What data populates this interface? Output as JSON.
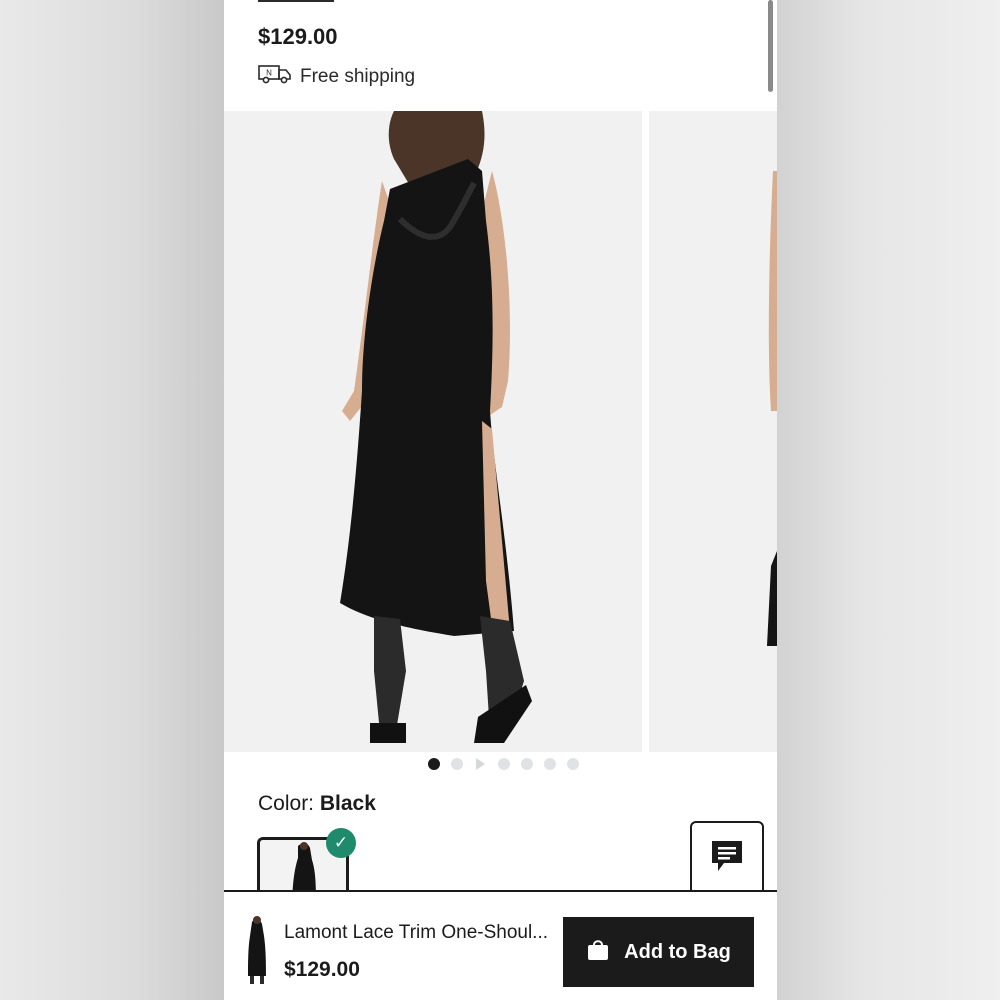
{
  "product": {
    "price": "$129.00",
    "shipping_text": "Free shipping",
    "color_prefix": "Color: ",
    "color_value": "Black"
  },
  "gallery": {
    "image_count": 6,
    "active_index": 0
  },
  "bottom_bar": {
    "title": "Lamont Lace Trim One-Shoul...",
    "price": "$129.00",
    "add_label": "Add to Bag"
  },
  "icons": {
    "shipping": "delivery-truck-icon",
    "chat": "chat-icon",
    "bag": "shopping-bag-icon",
    "check": "checkmark-icon",
    "play": "play-icon"
  },
  "colors": {
    "accent_check": "#1f8a6c",
    "button_bg": "#1b1b1b"
  }
}
